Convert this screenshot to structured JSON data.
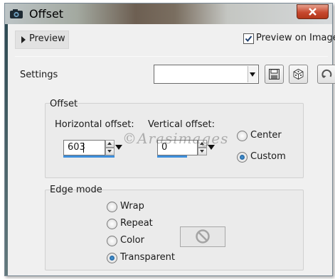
{
  "window": {
    "title": "Offset",
    "close_icon": "close-icon",
    "app_icon": "camera-icon"
  },
  "preview": {
    "button_label": "Preview",
    "checkbox_label": "Preview on Image",
    "checked": true
  },
  "settings": {
    "label": "Settings",
    "preset_value": "",
    "save_icon": "save-disk-icon",
    "random_icon": "dice-icon",
    "reset_icon": "reset-icon"
  },
  "offset_group": {
    "title": "Offset",
    "horizontal": {
      "label": "Horizontal offset:",
      "value": "603"
    },
    "vertical": {
      "label": "Vertical offset:",
      "value": "0"
    },
    "options": [
      {
        "label": "Center",
        "selected": false
      },
      {
        "label": "Custom",
        "selected": true
      }
    ]
  },
  "edge_group": {
    "title": "Edge mode",
    "options": [
      {
        "label": "Wrap",
        "selected": false
      },
      {
        "label": "Repeat",
        "selected": false
      },
      {
        "label": "Color",
        "selected": false
      },
      {
        "label": "Transparent",
        "selected": true
      }
    ],
    "color_swatch_icon": "no-color-icon"
  },
  "watermark": "©Arasimages",
  "colors": {
    "accent": "#3d8edb",
    "radio_selected": "#1560a8",
    "close_button": "#c7492f"
  }
}
